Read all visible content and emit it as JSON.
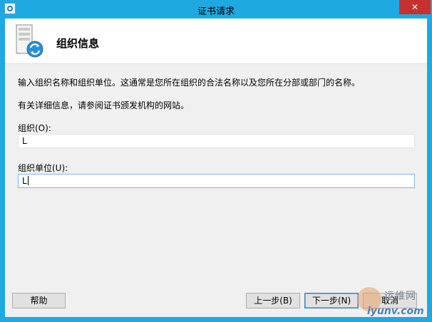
{
  "window": {
    "title": "证书请求",
    "close_symbol": "✕",
    "icon": "certificate-app-icon"
  },
  "header": {
    "title": "组织信息",
    "icon": "server-refresh-icon"
  },
  "body": {
    "description": "输入组织名称和组织单位。这通常是您所在组织的合法名称以及您所在分部或部门的名称。",
    "more_info": "有关详细信息，请参阅证书颁发机构的网站。",
    "org_label": "组织(O):",
    "org_value": "L",
    "ou_label": "组织单位(U):",
    "ou_value": "L"
  },
  "buttons": {
    "help": "帮助",
    "back": "上一步(B)",
    "next": "下一步(N)",
    "cancel": "取消"
  },
  "watermark": {
    "top": "运维网",
    "bottom": "iyunv.com"
  },
  "colors": {
    "titlebar": "#1fa9e1",
    "close": "#c7302c",
    "dialog_bg": "#f0f0f0"
  }
}
